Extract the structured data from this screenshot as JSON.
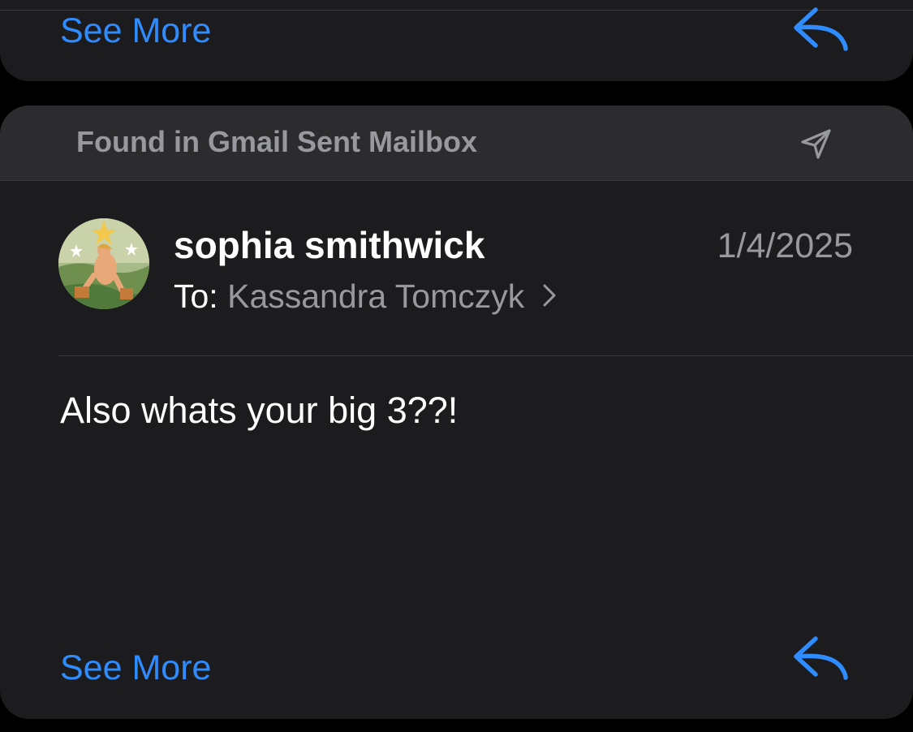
{
  "colors": {
    "accent": "#2f8cff",
    "card_bg": "#1c1c1e",
    "header_bg": "#2c2c2e",
    "secondary_text": "#98989f"
  },
  "previous_card": {
    "see_more_label": "See More",
    "reply_icon": "reply-arrow-icon"
  },
  "message_card": {
    "header": {
      "label": "Found in Gmail Sent Mailbox",
      "icon": "paper-plane-icon"
    },
    "sender": {
      "avatar": "avatar-tarot-card-image",
      "name": "sophia smithwick"
    },
    "date": "1/4/2025",
    "to_label": "To:",
    "recipient": "Kassandra Tomczyk",
    "body": "Also whats your big 3??!",
    "see_more_label": "See More",
    "reply_icon": "reply-arrow-icon"
  }
}
